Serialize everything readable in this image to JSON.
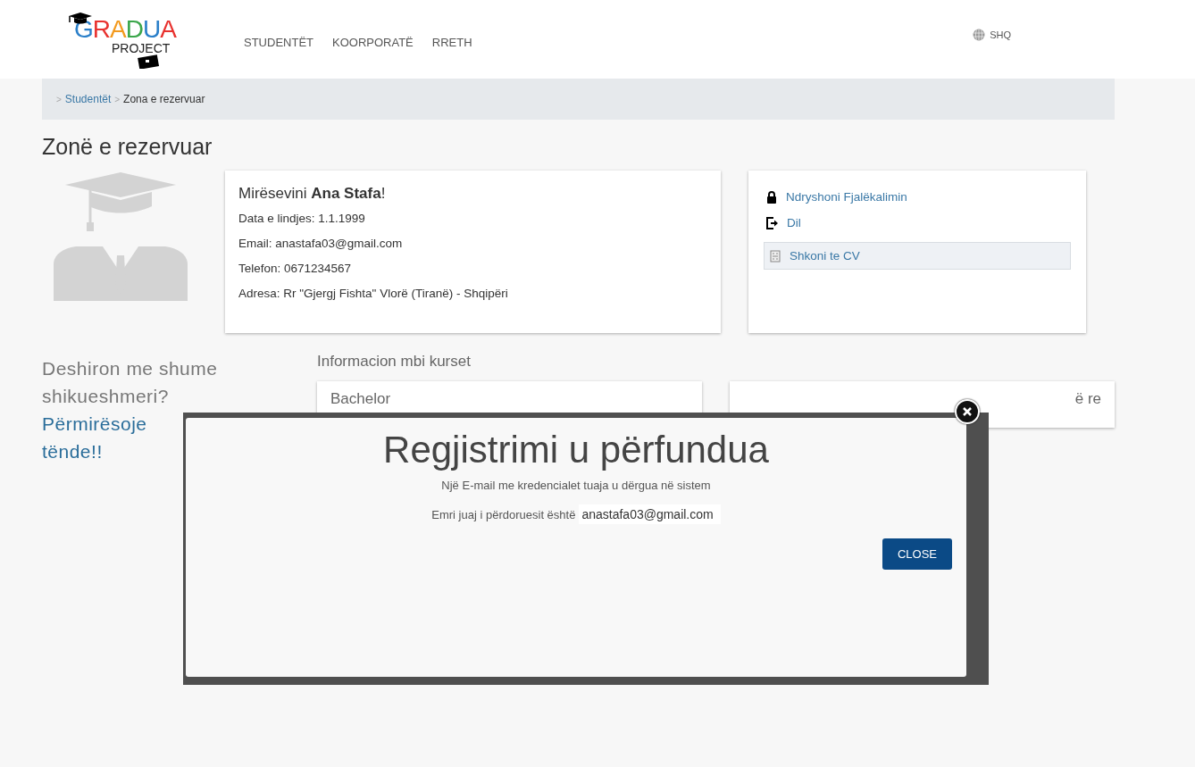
{
  "header": {
    "logo": {
      "letters": [
        {
          "char": "G",
          "color": "#2a7fc9"
        },
        {
          "char": "R",
          "color": "#e8322f"
        },
        {
          "char": "A",
          "color": "#f39a1e"
        },
        {
          "char": "D",
          "color": "#3aa64a"
        },
        {
          "char": "U",
          "color": "#2a7fc9"
        },
        {
          "char": "A",
          "color": "#e8322f"
        }
      ],
      "subtitle": "PROJECT"
    },
    "nav": [
      "STUDENTËT",
      "KOORPORATË",
      "RRETH"
    ],
    "language": "SHQ"
  },
  "breadcrumb": [
    {
      "separator": ">",
      "label": "Studentët",
      "link": true
    },
    {
      "separator": ">",
      "label": "Zona e rezervuar",
      "link": false
    }
  ],
  "page_title": "Zonë e rezervuar",
  "profile": {
    "greeting": "Mirësevini **Ana Stafa**!",
    "details": [
      "Data e lindjes: 1.1.1999",
      "Email: anastafa03@gmail.com",
      "Telefon: 0671234567",
      "Adresa: Rr \"Gjergj Fishta\" Vlorë (Tiranë) - Shqipëri"
    ]
  },
  "actions": [
    {
      "kind": "lock",
      "label": "Ndryshoni Fjalëkalimin"
    },
    {
      "kind": "logout",
      "label": "Dil"
    },
    {
      "kind": "cv",
      "label": "Shkoni te CV"
    }
  ],
  "promo": {
    "lines": [
      "Deshiron me shume",
      "shikueshmeri?"
    ],
    "link_lines": [
      "Përmirësoje",
      "tënde!!"
    ]
  },
  "courses": {
    "title": "Informacion mbi kurset",
    "cards": [
      "Bachelor",
      "ë re"
    ]
  },
  "modal": {
    "title": "Regjistrimi u përfundua",
    "message": "Një E-mail me kredencialet tuaja u dërgua në sistem",
    "username_label": "Emri juaj i përdoruesit është",
    "username": "anastafa03@gmail.com",
    "close_button": "CLOSE"
  }
}
